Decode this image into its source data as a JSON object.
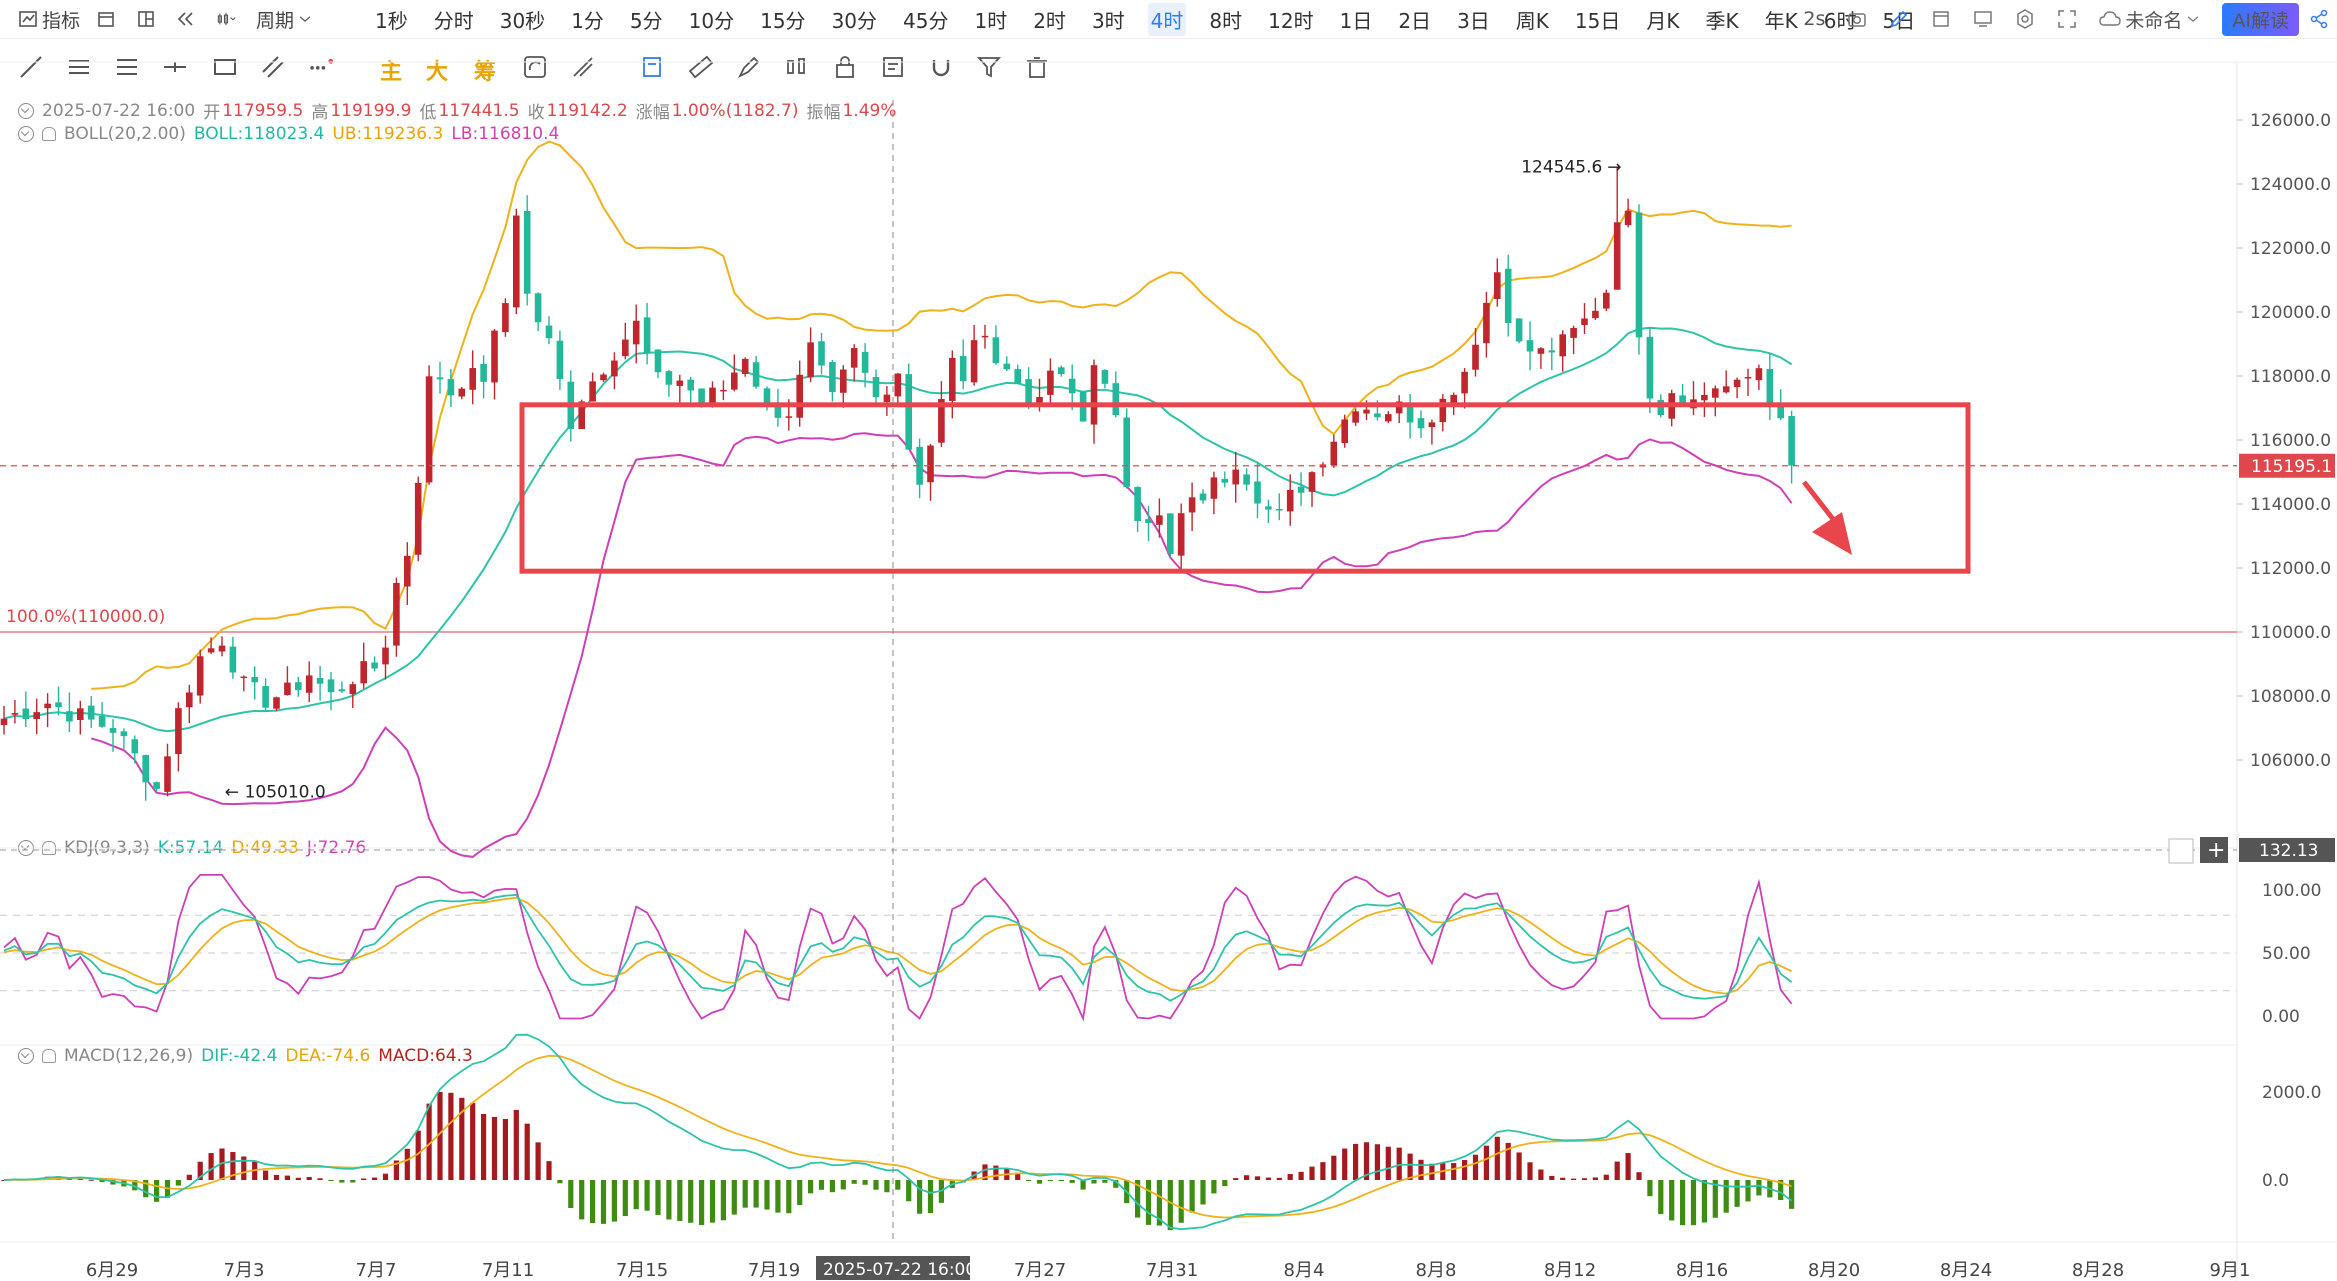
{
  "toolbar": {
    "indicator_label": "指标",
    "period_label": "周期",
    "periods": [
      "1秒",
      "分时",
      "30秒",
      "1分",
      "5分",
      "10分",
      "15分",
      "30分",
      "45分",
      "1时",
      "2时",
      "3时",
      "4时",
      "8时",
      "12时",
      "1日",
      "2日",
      "3日",
      "周K",
      "15日",
      "月K",
      "季K",
      "年K",
      "6时",
      "5日"
    ],
    "active_period": "4时",
    "refresh": "2s",
    "layout_name": "未命名",
    "ai_button": "AI解读"
  },
  "drawing_tools": {
    "labels": [
      "主",
      "大",
      "筹"
    ]
  },
  "ohlc": {
    "date": "2025-07-22 16:00",
    "open_label": "开",
    "open": "117959.5",
    "high_label": "高",
    "high": "119199.9",
    "low_label": "低",
    "low": "117441.5",
    "close_label": "收",
    "close": "119142.2",
    "change_label": "涨幅",
    "change": "1.00%(1182.7)",
    "amp_label": "振幅",
    "amp": "1.49%"
  },
  "boll": {
    "name": "BOLL(20,2.00)",
    "mid": "BOLL:118023.4",
    "ub": "UB:119236.3",
    "lb": "LB:116810.4"
  },
  "kdj": {
    "name": "KDJ(9,3,3)",
    "k": "K:57.14",
    "d": "D:49.33",
    "j": "J:72.76"
  },
  "macd": {
    "name": "MACD(12,26,9)",
    "dif": "DIF:-42.4",
    "dea": "DEA:-74.6",
    "macd": "MACD:64.3"
  },
  "colors": {
    "up": "#c0262d",
    "down": "#23b89a",
    "mid": "#2ec4a8",
    "ub": "#f0b21c",
    "lb": "#cf3fb8",
    "highlight": "#e8464c",
    "macd_down": "#3f8c12",
    "macd_up": "#a6191e"
  },
  "chart_data": {
    "type": "candlestick",
    "title": "",
    "ylim": [
      104000,
      127000
    ],
    "y_ticks": [
      "126000.0",
      "124000.0",
      "122000.0",
      "120000.0",
      "118000.0",
      "116000.0",
      "114000.0",
      "112000.0",
      "110000.0",
      "108000.0",
      "106000.0"
    ],
    "x_ticks": [
      "6月29",
      "7月3",
      "7月7",
      "7月11",
      "7月15",
      "7月19",
      "7月27",
      "7月31",
      "8月4",
      "8月8",
      "8月12",
      "8月16",
      "8月20",
      "8月24",
      "8月28",
      "9月1"
    ],
    "crosshair_date": "2025-07-22 16:00",
    "current_price": "115195.1",
    "max_label": "124545.6",
    "min_label": "105010.0",
    "fib_label": "100.0%(110000.0)",
    "fib_level": 110000,
    "highlight_box": {
      "top_price": 117100,
      "bottom_price": 111900,
      "start": "7月11",
      "end": "8月20"
    },
    "price_anchors": [
      [
        0,
        107300
      ],
      [
        4,
        107800
      ],
      [
        8,
        107200
      ],
      [
        10,
        107000
      ],
      [
        12,
        106100
      ],
      [
        14,
        105100
      ],
      [
        16,
        107500
      ],
      [
        18,
        109200
      ],
      [
        20,
        109800
      ],
      [
        22,
        108300
      ],
      [
        24,
        107900
      ],
      [
        26,
        108100
      ],
      [
        28,
        108700
      ],
      [
        30,
        108000
      ],
      [
        32,
        108600
      ],
      [
        34,
        108900
      ],
      [
        35,
        109700
      ],
      [
        36,
        111500
      ],
      [
        37,
        112500
      ],
      [
        38,
        114900
      ],
      [
        39,
        117800
      ],
      [
        40,
        118000
      ],
      [
        41,
        117500
      ],
      [
        42,
        117900
      ],
      [
        44,
        118000
      ],
      [
        46,
        120300
      ],
      [
        47,
        123200
      ],
      [
        48,
        120500
      ],
      [
        50,
        119000
      ],
      [
        52,
        116600
      ],
      [
        53,
        117400
      ],
      [
        56,
        118800
      ],
      [
        58,
        119600
      ],
      [
        59,
        118600
      ],
      [
        60,
        117800
      ],
      [
        62,
        117900
      ],
      [
        64,
        117200
      ],
      [
        66,
        117600
      ],
      [
        68,
        118700
      ],
      [
        70,
        117000
      ],
      [
        72,
        116900
      ],
      [
        74,
        118800
      ],
      [
        76,
        117200
      ],
      [
        78,
        118700
      ],
      [
        80,
        117300
      ],
      [
        82,
        118200
      ],
      [
        83,
        115800
      ],
      [
        84,
        114800
      ],
      [
        85,
        115900
      ],
      [
        87,
        118400
      ],
      [
        88,
        118000
      ],
      [
        90,
        119600
      ],
      [
        91,
        118500
      ],
      [
        93,
        117800
      ],
      [
        95,
        117000
      ],
      [
        96,
        118200
      ],
      [
        98,
        117400
      ],
      [
        99,
        116600
      ],
      [
        100,
        118600
      ],
      [
        102,
        116500
      ],
      [
        103,
        114700
      ],
      [
        104,
        113800
      ],
      [
        106,
        113500
      ],
      [
        107,
        112300
      ],
      [
        108,
        113600
      ],
      [
        110,
        114300
      ],
      [
        112,
        114900
      ],
      [
        113,
        115400
      ],
      [
        114,
        114900
      ],
      [
        116,
        113800
      ],
      [
        117,
        113600
      ],
      [
        118,
        114200
      ],
      [
        120,
        115000
      ],
      [
        122,
        116100
      ],
      [
        124,
        117200
      ],
      [
        126,
        116900
      ],
      [
        128,
        117000
      ],
      [
        130,
        116600
      ],
      [
        132,
        117200
      ],
      [
        134,
        118200
      ],
      [
        136,
        120300
      ],
      [
        137,
        121300
      ],
      [
        138,
        120000
      ],
      [
        139,
        118900
      ],
      [
        141,
        118700
      ],
      [
        143,
        119000
      ],
      [
        145,
        119700
      ],
      [
        147,
        120700
      ],
      [
        148,
        123100
      ],
      [
        149,
        122900
      ],
      [
        150,
        119500
      ],
      [
        151,
        117600
      ],
      [
        152,
        117000
      ],
      [
        153,
        117600
      ],
      [
        155,
        117200
      ],
      [
        157,
        117700
      ],
      [
        159,
        117600
      ],
      [
        161,
        118300
      ],
      [
        163,
        116400
      ],
      [
        164,
        115200
      ]
    ],
    "kdj_ylim": [
      -10,
      115
    ],
    "kdj_ticks": [
      "100.00",
      "50.00",
      "0.00"
    ],
    "kdj_cursor": "132.13",
    "macd_ylim": [
      -3000,
      3000
    ],
    "macd_ticks": [
      "2000.0",
      "0.0"
    ]
  }
}
